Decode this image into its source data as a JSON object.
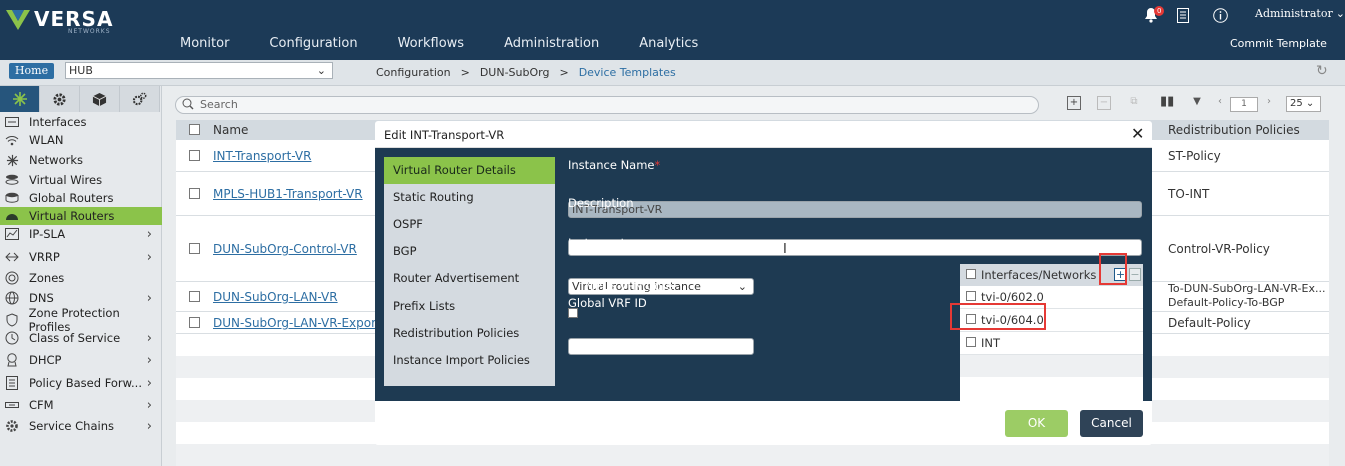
{
  "brand": {
    "name": "VERSA",
    "sub": "NETWORKS"
  },
  "header": {
    "notification_count": "0",
    "user": "Administrator",
    "nav": [
      "Monitor",
      "Configuration",
      "Workflows",
      "Administration",
      "Analytics"
    ],
    "commit": "Commit Template"
  },
  "context_bar": {
    "home": "Home",
    "org": "HUB",
    "breadcrumb": [
      "Configuration",
      ">",
      "DUN-SubOrg",
      ">",
      "Device Templates"
    ]
  },
  "sidebar": {
    "items": [
      {
        "label": "Interfaces",
        "icon": "interfaces-icon",
        "expandable": false
      },
      {
        "label": "WLAN",
        "icon": "wifi-icon",
        "expandable": false
      },
      {
        "label": "Networks",
        "icon": "network-icon",
        "expandable": false
      },
      {
        "label": "Virtual Wires",
        "icon": "wires-icon",
        "expandable": false
      },
      {
        "label": "Global Routers",
        "icon": "router-icon",
        "expandable": false
      },
      {
        "label": "Virtual Routers",
        "icon": "router-icon",
        "expandable": false
      },
      {
        "label": "IP-SLA",
        "icon": "sla-icon",
        "expandable": true
      },
      {
        "label": "VRRP",
        "icon": "vrrp-icon",
        "expandable": true
      },
      {
        "label": "Zones",
        "icon": "zones-icon",
        "expandable": false
      },
      {
        "label": "DNS",
        "icon": "dns-icon",
        "expandable": true
      },
      {
        "label": "Zone Protection Profiles",
        "icon": "shield-icon",
        "expandable": false
      },
      {
        "label": "Class of Service",
        "icon": "cos-icon",
        "expandable": true
      },
      {
        "label": "DHCP",
        "icon": "dhcp-icon",
        "expandable": true
      },
      {
        "label": "Policy Based Forw...",
        "icon": "pbf-icon",
        "expandable": true
      },
      {
        "label": "CFM",
        "icon": "cfm-icon",
        "expandable": true
      },
      {
        "label": "Service Chains",
        "icon": "gear-icon",
        "expandable": true
      }
    ]
  },
  "toolbar": {
    "search_placeholder": "Search",
    "page": "1",
    "page_size": "25"
  },
  "grid": {
    "columns": {
      "name": "Name",
      "policies": "Redistribution Policies"
    },
    "rows": [
      {
        "name": "INT-Transport-VR",
        "policies": "ST-Policy"
      },
      {
        "name": "MPLS-HUB1-Transport-VR",
        "policies": "TO-INT"
      },
      {
        "name": "DUN-SubOrg-Control-VR",
        "policies": "Control-VR-Policy"
      },
      {
        "name": "DUN-SubOrg-LAN-VR",
        "policies": "To-DUN-SubOrg-LAN-VR-Ex...",
        "policies2": "Default-Policy-To-BGP"
      },
      {
        "name": "DUN-SubOrg-LAN-VR-Export",
        "policies": "Default-Policy"
      }
    ]
  },
  "modal": {
    "title": "Edit INT-Transport-VR",
    "nav": [
      "Virtual Router Details",
      "Static Routing",
      "OSPF",
      "BGP",
      "Router Advertisement",
      "Prefix Lists",
      "Redistribution Policies",
      "Instance Import Policies"
    ],
    "fields": {
      "instance_name_label": "Instance Name",
      "required_mark": "*",
      "instance_name_value": "INT-Transport-VR",
      "description_label": "Description",
      "description_value": "",
      "instance_type_label": "Instance type",
      "instance_type_value": "Virtual routing instance",
      "mpls_label": "MPLS VPN Core",
      "vrf_label": "Global VRF ID",
      "vrf_value": ""
    },
    "interfaces": {
      "header": "Interfaces/Networks",
      "items": [
        "tvi-0/602.0",
        "tvi-0/604.0",
        "INT"
      ]
    },
    "buttons": {
      "ok": "OK",
      "cancel": "Cancel"
    }
  },
  "colors": {
    "accent": "#8bc34a",
    "header": "#1c3a57",
    "modal_body": "#1e3a52",
    "highlight": "#e53935"
  }
}
